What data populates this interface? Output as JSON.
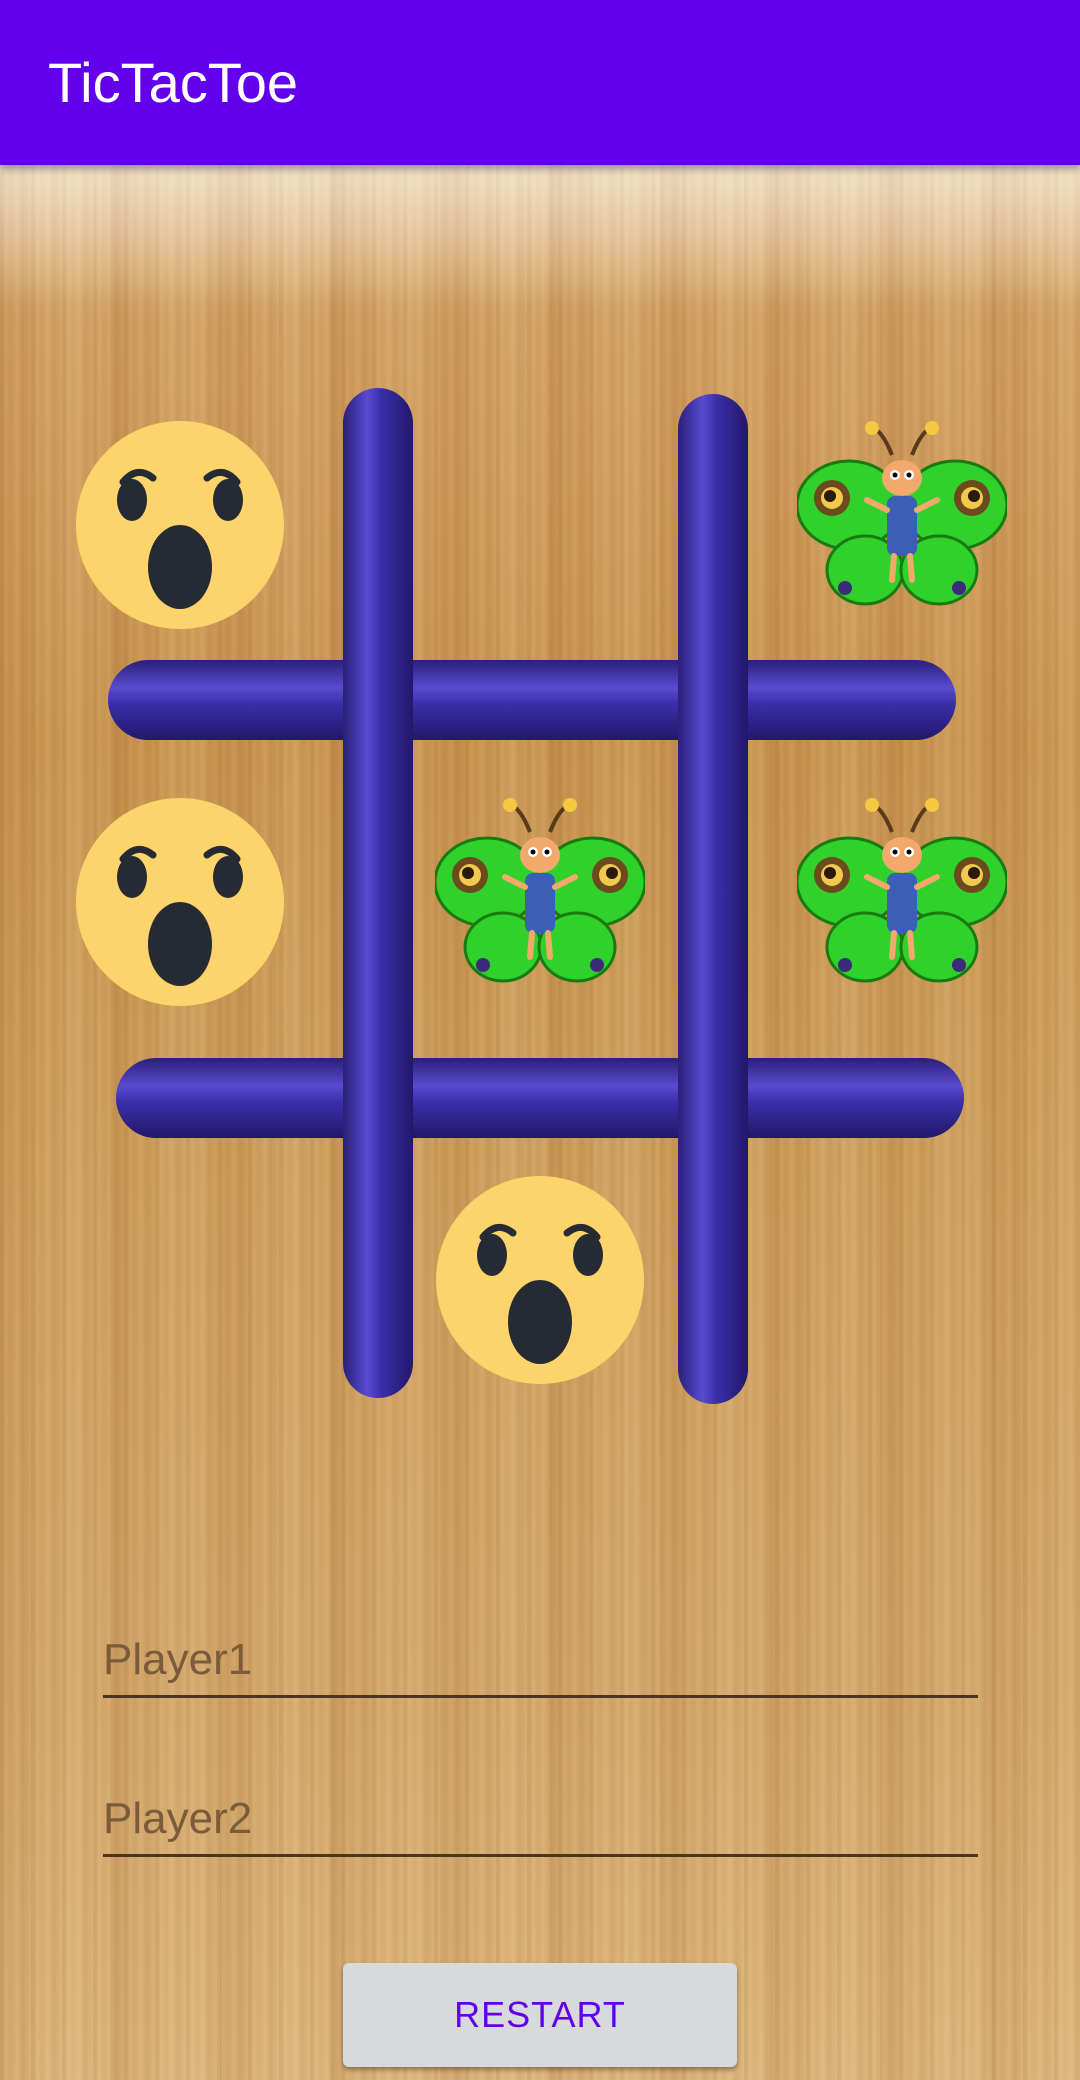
{
  "app_bar": {
    "title": "TicTacToe",
    "color": "#6200ee"
  },
  "board": {
    "grid_color": "#3d2fa6",
    "cells": [
      {
        "row": 0,
        "col": 0,
        "piece": "wow-emoji"
      },
      {
        "row": 0,
        "col": 1,
        "piece": ""
      },
      {
        "row": 0,
        "col": 2,
        "piece": "butterfly"
      },
      {
        "row": 1,
        "col": 0,
        "piece": "wow-emoji"
      },
      {
        "row": 1,
        "col": 1,
        "piece": "butterfly"
      },
      {
        "row": 1,
        "col": 2,
        "piece": "butterfly"
      },
      {
        "row": 2,
        "col": 0,
        "piece": ""
      },
      {
        "row": 2,
        "col": 1,
        "piece": "wow-emoji"
      },
      {
        "row": 2,
        "col": 2,
        "piece": ""
      }
    ]
  },
  "players": {
    "player1_placeholder": "Player1",
    "player1_value": "",
    "player2_placeholder": "Player2",
    "player2_value": ""
  },
  "restart_button": {
    "label": "RESTART",
    "text_color": "#6200ee"
  }
}
